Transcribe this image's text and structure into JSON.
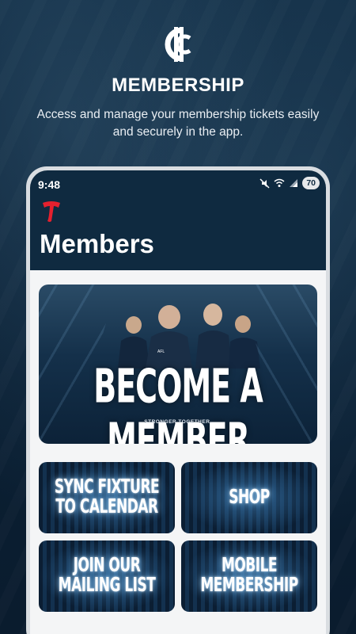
{
  "promo": {
    "title": "MEMBERSHIP",
    "subtitle": "Access and manage your membership tickets easily and securely in the app."
  },
  "status_bar": {
    "time": "9:48",
    "battery": "70",
    "icons": [
      "mute-icon",
      "wifi-icon",
      "signal-icon"
    ]
  },
  "app": {
    "page_title": "Members",
    "brand_color": "#0f2a40",
    "accent_color": "#e5202e"
  },
  "hero_banner": {
    "headline": "BECOME A MEMBER",
    "tagline": "STRONGER TOGETHER."
  },
  "tiles": [
    {
      "label": "SYNC FIXTURE\nTO CALENDAR"
    },
    {
      "label": "SHOP"
    },
    {
      "label": "JOIN OUR\nMAILING LIST"
    },
    {
      "label": "MOBILE\nMEMBERSHIP"
    }
  ]
}
